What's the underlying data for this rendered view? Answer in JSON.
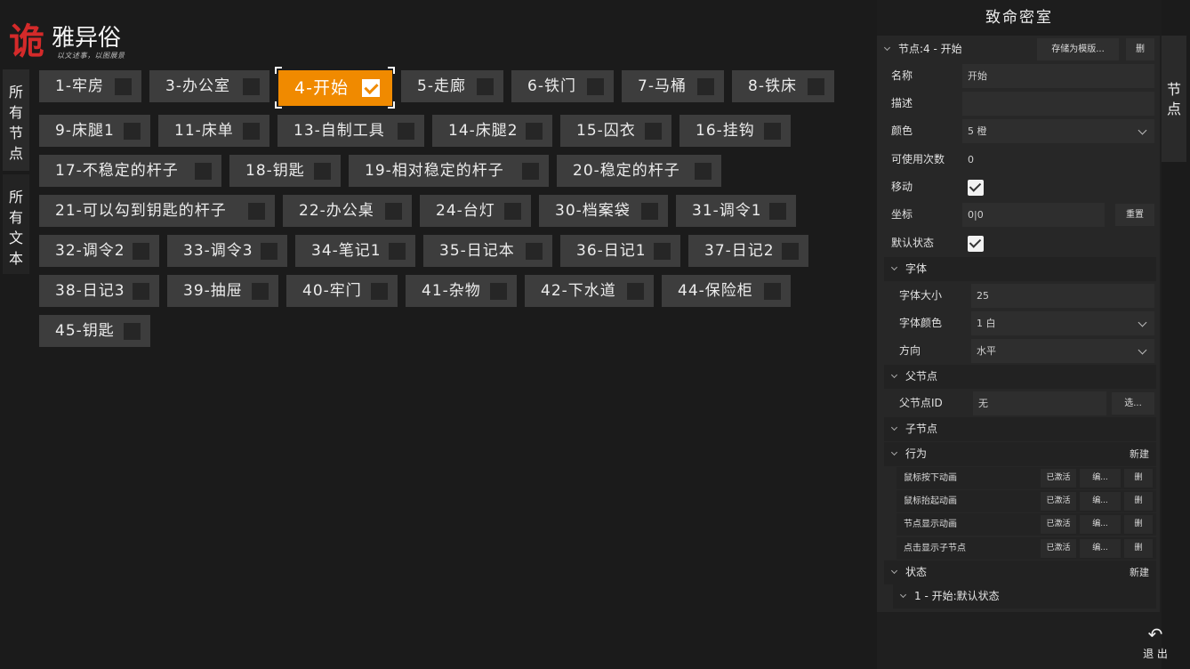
{
  "logo": {
    "big": "诡",
    "rest": "雅异俗",
    "tagline": "以文述事，以图展景"
  },
  "left_tabs": [
    "所有节点",
    "所有文本"
  ],
  "nodes": [
    "1-牢房",
    "3-办公室",
    "4-开始",
    "5-走廊",
    "6-铁门",
    "7-马桶",
    "8-铁床",
    "9-床腿1",
    "11-床单",
    "13-自制工具",
    "14-床腿2",
    "15-囚衣",
    "16-挂钩",
    "17-不稳定的杆子",
    "18-钥匙",
    "19-相对稳定的杆子",
    "20-稳定的杆子",
    "21-可以勾到钥匙的杆子",
    "22-办公桌",
    "24-台灯",
    "30-档案袋",
    "31-调令1",
    "32-调令2",
    "33-调令3",
    "34-笔记1",
    "35-日记本",
    "36-日记1",
    "37-日记2",
    "38-日记3",
    "39-抽屉",
    "40-牢门",
    "41-杂物",
    "42-下水道",
    "44-保险柜",
    "45-钥匙"
  ],
  "active_node": "4-开始",
  "panel": {
    "title": "致命密室",
    "node_header": "节点:4 - 开始",
    "save_template": "存储为模版...",
    "delete": "删",
    "name_label": "名称",
    "name_value": "开始",
    "desc_label": "描述",
    "desc_value": "",
    "color_label": "颜色",
    "color_value": "5 橙",
    "uses_label": "可使用次数",
    "uses_value": "0",
    "move_label": "移动",
    "coord_label": "坐标",
    "coord_value": "0|0",
    "reset": "重置",
    "default_state_label": "默认状态",
    "font_section": "字体",
    "font_size_label": "字体大小",
    "font_size_value": "25",
    "font_color_label": "字体颜色",
    "font_color_value": "1 白",
    "direction_label": "方向",
    "direction_value": "水平",
    "parent_section": "父节点",
    "parent_id_label": "父节点ID",
    "parent_id_value": "无",
    "select": "选...",
    "children_section": "子节点",
    "behavior_section": "行为",
    "new": "新建",
    "behaviors": [
      {
        "name": "鼠标按下动画",
        "status": "已激活",
        "edit": "编...",
        "del": "删"
      },
      {
        "name": "鼠标抬起动画",
        "status": "已激活",
        "edit": "编...",
        "del": "删"
      },
      {
        "name": "节点显示动画",
        "status": "已激活",
        "edit": "编...",
        "del": "删"
      },
      {
        "name": "点击显示子节点",
        "status": "已激活",
        "edit": "编...",
        "del": "删"
      }
    ],
    "state_section": "状态",
    "state_item": "1 - 开始:默认状态"
  },
  "right_tab": "节点",
  "exit": "退 出",
  "colors": {
    "accent": "#f08a00",
    "bg": "#1b1b1b",
    "node": "#3d3d3d"
  }
}
